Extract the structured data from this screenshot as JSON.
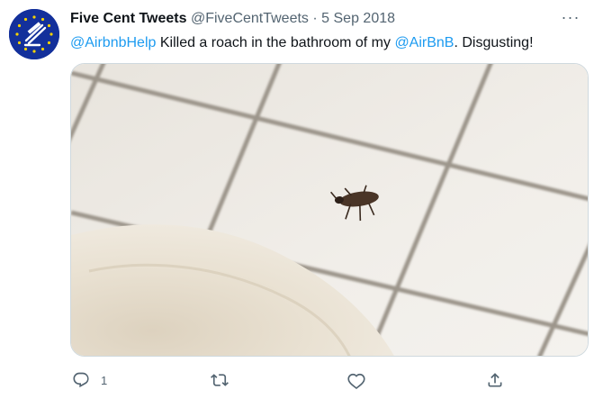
{
  "tweet": {
    "author_name": "Five Cent Tweets",
    "handle": "@FiveCentTweets",
    "separator": "·",
    "date": "5 Sep 2018",
    "text_parts": {
      "mention1": "@AirbnbHelp",
      "middle": " Killed a roach in the bathroom of my ",
      "mention2": "@AirBnB",
      "end": ". Disgusting!"
    },
    "media_alt": "Image",
    "reply_count": "1"
  },
  "icons": {
    "avatar": "eu-flag-logo",
    "more": "more-horizontal-icon",
    "reply": "reply-icon",
    "retweet": "retweet-icon",
    "like": "heart-icon",
    "share": "share-icon"
  },
  "colors": {
    "mention": "#1d9bf0",
    "secondary_text": "#536471",
    "avatar_bg": "#13309b"
  },
  "more_glyph": "···"
}
